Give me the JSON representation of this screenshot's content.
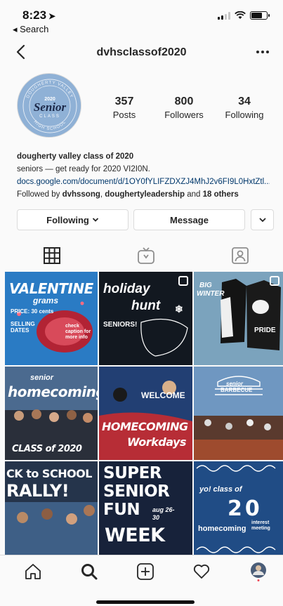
{
  "status": {
    "time": "8:23",
    "back_label": "◂ Search"
  },
  "header": {
    "username": "dvhsclassof2020"
  },
  "avatar": {
    "ring_top": "DOUGHERTY VALLEY",
    "year": "2020",
    "word": "Senior",
    "sub": "CLASS",
    "ring_bottom": "HIGH SCHOOL"
  },
  "stats": [
    {
      "value": "357",
      "label": "Posts"
    },
    {
      "value": "800",
      "label": "Followers"
    },
    {
      "value": "34",
      "label": "Following"
    }
  ],
  "bio": {
    "name": "dougherty valley class of 2020",
    "line": "seniors — get ready for 2020 VI2I0N.",
    "link": "docs.google.com/document/d/1OY0fYLIFZDXZJ4MhJ2v6FI9L0HxtZtl...",
    "followed_prefix": "Followed by ",
    "followed_user1": "dvhssong",
    "followed_sep": ", ",
    "followed_user2": "doughertyleadership",
    "followed_and": " and ",
    "followed_others": "18 others"
  },
  "buttons": {
    "following": "Following",
    "message": "Message"
  },
  "posts": [
    {
      "l1": "VALENTINE",
      "l2": "grams",
      "l3": "PRICE: 30 cents",
      "l4": "SELLING DATES",
      "l5": "check caption for more info"
    },
    {
      "l1": "holiday",
      "l2": "hunt",
      "l3": "SENIORS!"
    },
    {
      "l1": "BIG",
      "l2": "WINTER",
      "l3": "PRIDE"
    },
    {
      "l1": "senior",
      "l2": "homecoming",
      "l3": "CLASS of 2020"
    },
    {
      "l1": "WELCOME",
      "l2": "HOMECOMING",
      "l3": "Workdays"
    },
    {
      "l1": "senior",
      "l2": "BARBECUE"
    },
    {
      "l1": "CK to SCHOOL",
      "l2": "RALLY!"
    },
    {
      "l1": "SUPER",
      "l2": "SENIOR",
      "l3": "FUN",
      "l4": "WEEK",
      "l5": "aug 26-30"
    },
    {
      "l1": "yo! class of",
      "l2": "20",
      "l3": "homecoming",
      "l4": "interest meeting"
    }
  ],
  "colors": {
    "link": "#00376b",
    "avatar_bg": "#8fb1d6",
    "border": "#dbdbdb"
  }
}
